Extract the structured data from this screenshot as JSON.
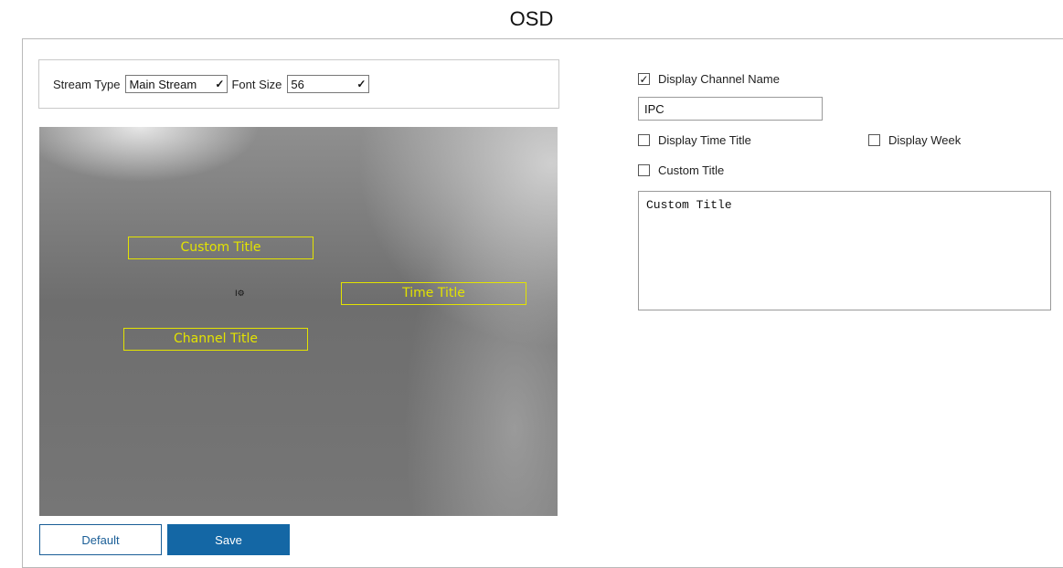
{
  "page": {
    "title": "OSD"
  },
  "toolbar": {
    "stream_type_label": "Stream Type",
    "stream_type_value": "Main Stream",
    "font_size_label": "Font Size",
    "font_size_value": "56"
  },
  "preview": {
    "overlays": {
      "custom_title": "Custom Title",
      "time_title": "Time Title",
      "channel_title": "Channel Title"
    },
    "cursor_text": "I⚙"
  },
  "buttons": {
    "default_label": "Default",
    "save_label": "Save"
  },
  "settings": {
    "display_channel_name": {
      "label": "Display Channel Name",
      "checked": true
    },
    "channel_name_value": "IPC",
    "display_time_title": {
      "label": "Display Time Title",
      "checked": false
    },
    "display_week": {
      "label": "Display Week",
      "checked": false
    },
    "custom_title": {
      "label": "Custom Title",
      "checked": false
    },
    "custom_title_text": "Custom Title"
  },
  "colors": {
    "accent": "#1467a5",
    "osd_box": "#e3e300"
  }
}
